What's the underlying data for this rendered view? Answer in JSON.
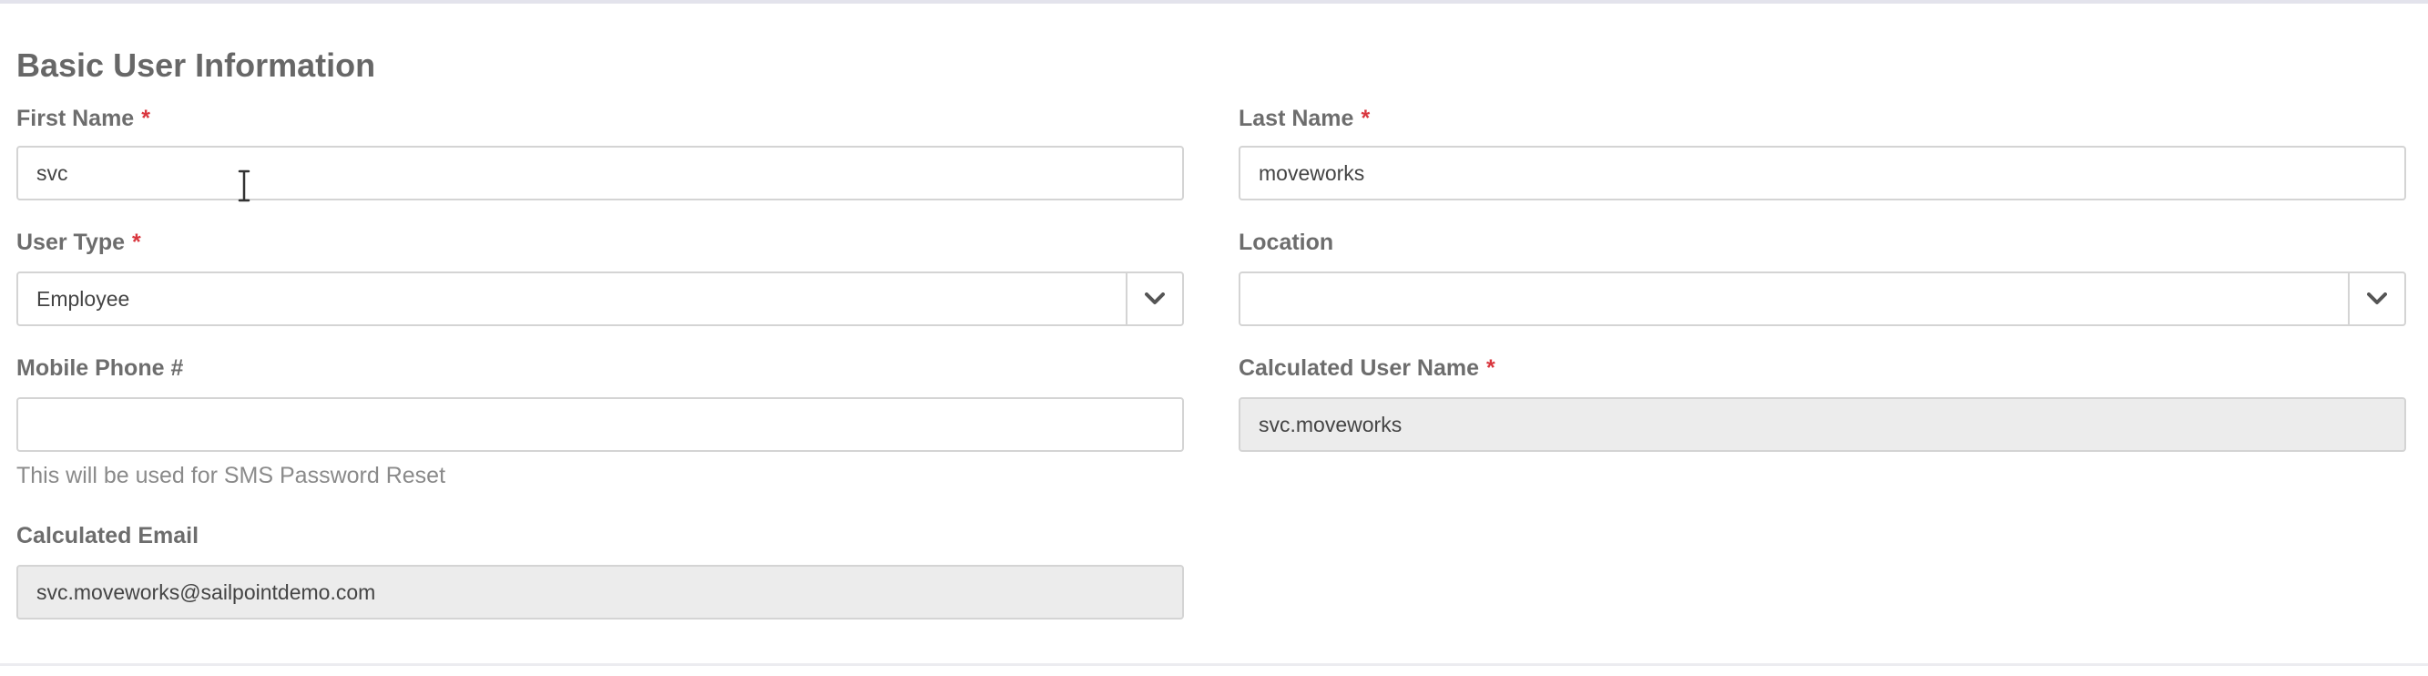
{
  "section": {
    "title": "Basic User Information"
  },
  "required_marker": "*",
  "fields": {
    "first_name": {
      "label": "First Name",
      "value": "svc",
      "required": true
    },
    "last_name": {
      "label": "Last Name",
      "value": "moveworks",
      "required": true
    },
    "user_type": {
      "label": "User Type",
      "value": "Employee",
      "required": true
    },
    "location": {
      "label": "Location",
      "value": "",
      "required": false
    },
    "mobile_phone": {
      "label": "Mobile Phone #",
      "value": "",
      "help": "This will be used for SMS Password Reset",
      "required": false
    },
    "calculated_user_name": {
      "label": "Calculated User Name",
      "value": "svc.moveworks",
      "required": true,
      "readonly": true
    },
    "calculated_email": {
      "label": "Calculated Email",
      "value": "svc.moveworks@sailpointdemo.com",
      "required": false,
      "readonly": true
    }
  },
  "colors": {
    "required": "#d9363e",
    "border": "#d4d4d4",
    "readonly_bg": "#ececec",
    "label": "#6d6d6d"
  },
  "icons": {
    "dropdown": "chevron-down-icon",
    "cursor": "text-cursor-icon"
  }
}
